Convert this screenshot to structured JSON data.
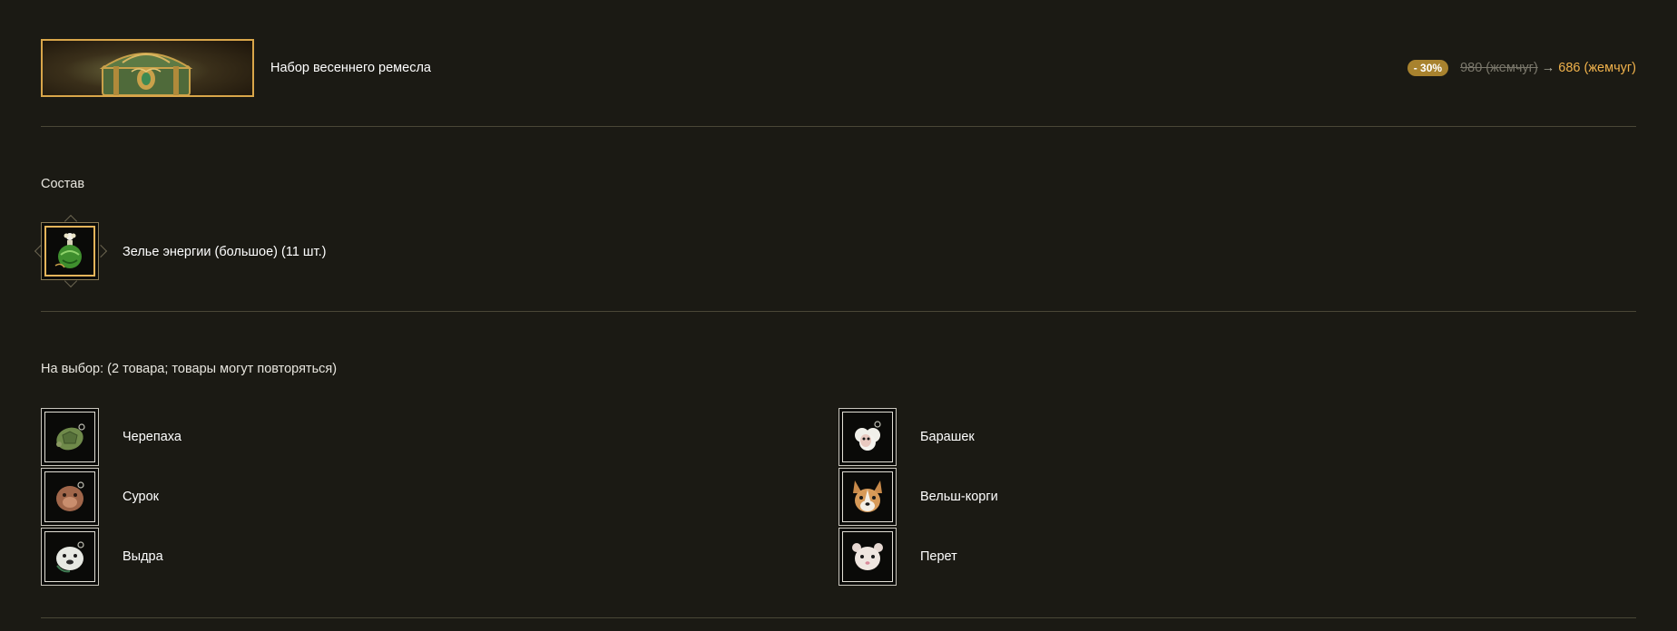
{
  "product": {
    "title": "Набор весеннего ремесла",
    "discount": "- 30%",
    "old_price": "980 (жемчуг)",
    "arrow": "→",
    "new_price": "686 (жемчуг)"
  },
  "contents": {
    "label": "Состав",
    "items": [
      {
        "name": "Зелье энергии (большое) (11 шт.)",
        "icon": "energy-potion-icon"
      }
    ]
  },
  "choice": {
    "label": "На выбор: (2 товара; товары могут повторяться)",
    "items": [
      {
        "name": "Черепаха",
        "icon": "turtle-icon"
      },
      {
        "name": "Барашек",
        "icon": "sheep-icon"
      },
      {
        "name": "Сурок",
        "icon": "marmot-icon"
      },
      {
        "name": "Вельш-корги",
        "icon": "corgi-icon"
      },
      {
        "name": "Выдра",
        "icon": "otter-icon"
      },
      {
        "name": "Перет",
        "icon": "ferret-icon"
      }
    ]
  },
  "colors": {
    "background": "#1b1a14",
    "accent_gold": "#e4b45a",
    "discount_badge": "#a8822e",
    "new_price": "#f0b24c",
    "old_price": "#7b786c"
  }
}
